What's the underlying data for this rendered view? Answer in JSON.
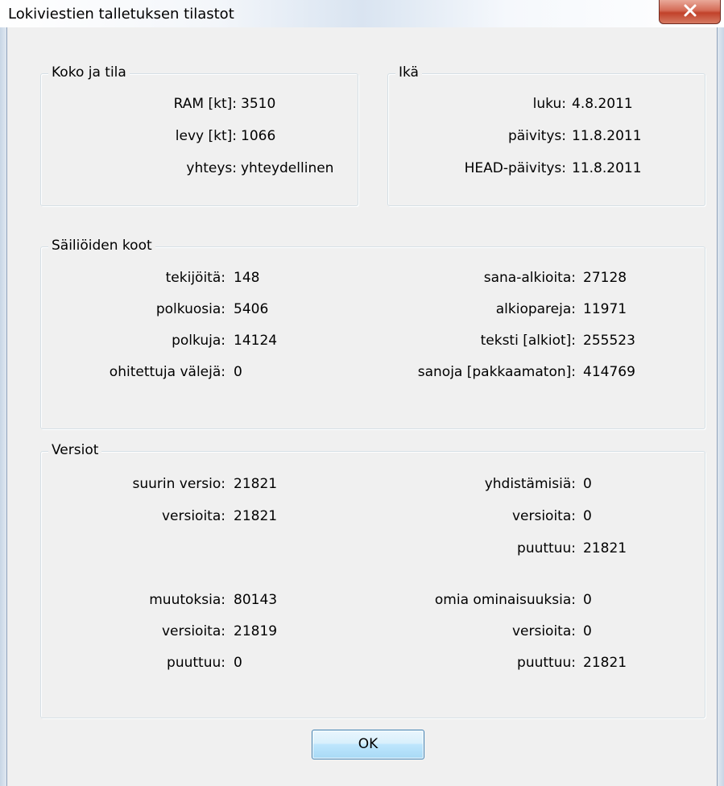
{
  "window": {
    "title": "Lokiviestien talletuksen tilastot"
  },
  "size_group": {
    "caption": "Koko ja tila",
    "rows": [
      {
        "label": "RAM [kt]:",
        "value": "3510"
      },
      {
        "label": "levy [kt]:",
        "value": "1066"
      },
      {
        "label": "yhteys:",
        "value": "yhteydellinen"
      }
    ]
  },
  "age_group": {
    "caption": "Ikä",
    "rows": [
      {
        "label": "luku:",
        "value": "4.8.2011"
      },
      {
        "label": "päivitys:",
        "value": "11.8.2011"
      },
      {
        "label": "HEAD-päivitys:",
        "value": "11.8.2011"
      }
    ]
  },
  "containers_group": {
    "caption": "Säiliöiden koot",
    "left": [
      {
        "label": "tekijöitä:",
        "value": "148"
      },
      {
        "label": "polkuosia:",
        "value": "5406"
      },
      {
        "label": "polkuja:",
        "value": "14124"
      },
      {
        "label": "ohitettuja välejä:",
        "value": "0"
      }
    ],
    "right": [
      {
        "label": "sana-alkioita:",
        "value": "27128"
      },
      {
        "label": "alkiopareja:",
        "value": "11971"
      },
      {
        "label": "teksti [alkiot]:",
        "value": "255523"
      },
      {
        "label": "sanoja [pakkaamaton]:",
        "value": "414769"
      }
    ]
  },
  "revisions_group": {
    "caption": "Versiot",
    "left_top": [
      {
        "label": "suurin versio:",
        "value": "21821"
      },
      {
        "label": "versioita:",
        "value": "21821"
      }
    ],
    "right_top": [
      {
        "label": "yhdistämisiä:",
        "value": "0"
      },
      {
        "label": "versioita:",
        "value": "0"
      },
      {
        "label": "puuttuu:",
        "value": "21821"
      }
    ],
    "left_bottom": [
      {
        "label": "muutoksia:",
        "value": "80143"
      },
      {
        "label": "versioita:",
        "value": "21819"
      },
      {
        "label": "puuttuu:",
        "value": "0"
      }
    ],
    "right_bottom": [
      {
        "label": "omia ominaisuuksia:",
        "value": "0"
      },
      {
        "label": "versioita:",
        "value": "0"
      },
      {
        "label": "puuttuu:",
        "value": "21821"
      }
    ]
  },
  "buttons": {
    "ok": "OK"
  },
  "icons": {
    "close": "close-icon"
  }
}
